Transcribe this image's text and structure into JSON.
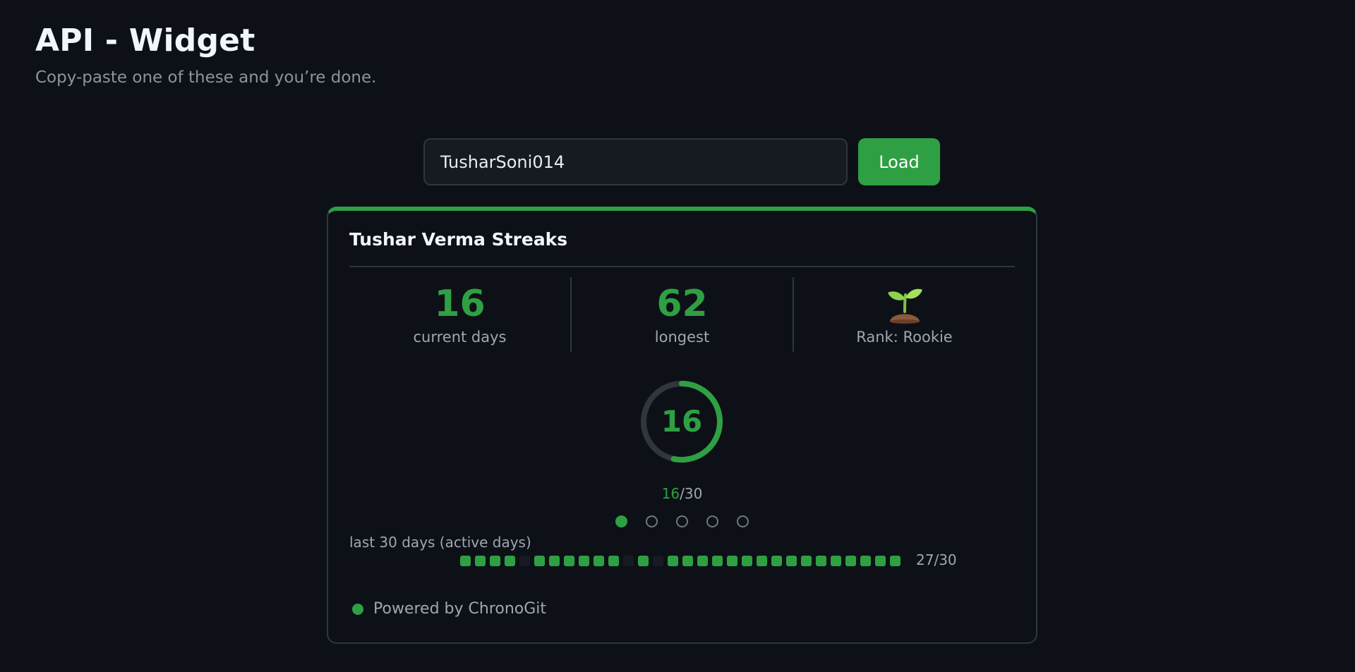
{
  "header": {
    "title": "API - Widget",
    "subtitle": "Copy-paste one of these and you’re done."
  },
  "search": {
    "value": "TusharSoni014",
    "button_label": "Load"
  },
  "card": {
    "accent_color": "#2ea043",
    "title": "Tushar Verma Streaks",
    "stats": {
      "current_value": "16",
      "current_label": "current days",
      "longest_value": "62",
      "longest_label": "longest",
      "rank_icon": "seedling-icon",
      "rank_label": "Rank: Rookie"
    },
    "goal": {
      "current": 16,
      "target": 30,
      "current_text": "16",
      "target_text": "/30"
    },
    "pager": {
      "count": 5,
      "active_index": 0
    },
    "activity": {
      "label": "last 30 days (active days)",
      "days": [
        1,
        1,
        1,
        1,
        0,
        1,
        1,
        1,
        1,
        1,
        1,
        0,
        1,
        0,
        1,
        1,
        1,
        1,
        1,
        1,
        1,
        1,
        1,
        1,
        1,
        1,
        1,
        1,
        1,
        1
      ],
      "summary": "27/30"
    },
    "footer": {
      "text": "Powered by ChronoGit"
    }
  }
}
